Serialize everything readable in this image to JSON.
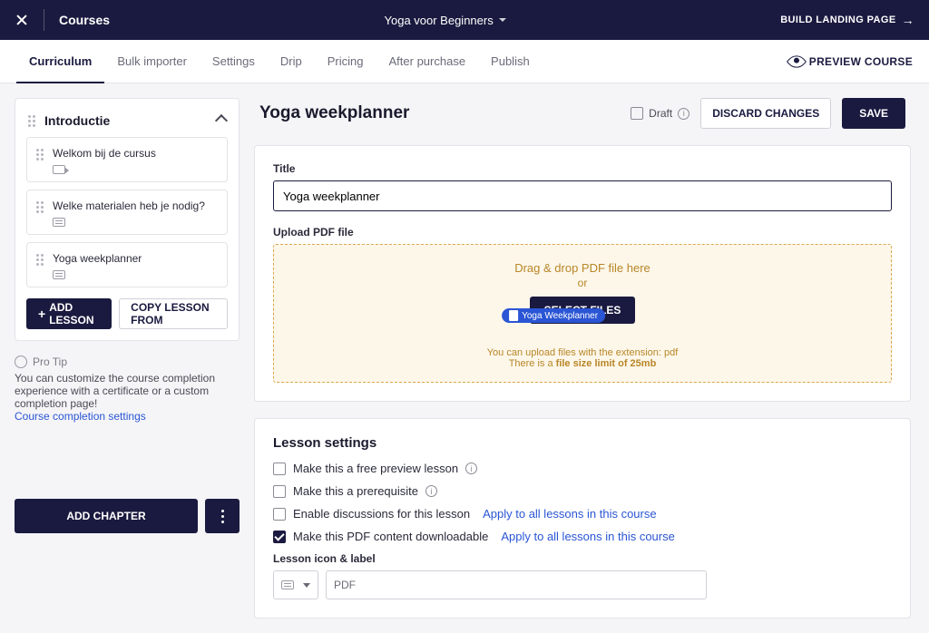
{
  "topbar": {
    "crumb": "Courses",
    "course_name": "Yoga voor Beginners",
    "build_label": "BUILD LANDING PAGE"
  },
  "tabs": {
    "items": [
      "Curriculum",
      "Bulk importer",
      "Settings",
      "Drip",
      "Pricing",
      "After purchase",
      "Publish"
    ],
    "preview_label": "PREVIEW COURSE"
  },
  "sidebar": {
    "chapter": "Introductie",
    "lessons": [
      {
        "name": "Welkom bij de cursus"
      },
      {
        "name": "Welke materialen heb je nodig?"
      },
      {
        "name": "Yoga weekplanner"
      }
    ],
    "add_lesson": "ADD LESSON",
    "copy_lesson": "COPY LESSON FROM",
    "protip_head": "Pro Tip",
    "protip_body": "You can customize the course completion experience with a certificate or a custom completion page!",
    "protip_link": "Course completion settings",
    "add_chapter": "ADD CHAPTER"
  },
  "editor": {
    "page_title": "Yoga weekplanner",
    "draft_label": "Draft",
    "discard": "DISCARD CHANGES",
    "save": "SAVE",
    "title_label": "Title",
    "title_value": "Yoga weekplanner",
    "upload_label": "Upload PDF file",
    "dd_text": "Drag & drop PDF file here",
    "or": "or",
    "select_files": "SELECT FILES",
    "chip": "Yoga Weekplanner",
    "ext_note": "You can upload files with the extension: pdf",
    "size_note_pre": "There is a ",
    "size_note_strong": "file size limit of 25mb"
  },
  "settings": {
    "heading": "Lesson settings",
    "free_preview": "Make this a free preview lesson",
    "prereq": "Make this a prerequisite",
    "discussions": "Enable discussions for this lesson",
    "downloadable": "Make this PDF content downloadable",
    "apply_all": "Apply to all lessons in this course",
    "icon_label": "Lesson icon & label",
    "pdf_placeholder": "PDF"
  }
}
